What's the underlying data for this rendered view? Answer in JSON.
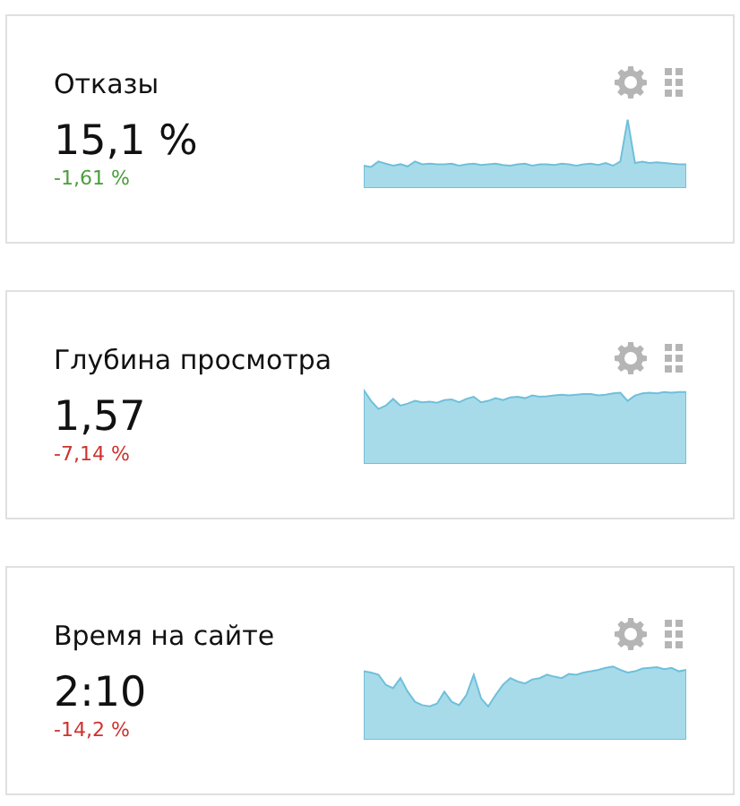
{
  "cards": [
    {
      "title": "Отказы",
      "value": "15,1 %",
      "change": "-1,61 %",
      "color": "#4a9d3c"
    },
    {
      "title": "Глубина просмотра",
      "value": "1,57",
      "change": "-7,14 %",
      "color": "#d0312d"
    },
    {
      "title": "Время на сайте",
      "value": "2:10",
      "change": "-14,2 %",
      "color": "#d0312d"
    }
  ]
}
